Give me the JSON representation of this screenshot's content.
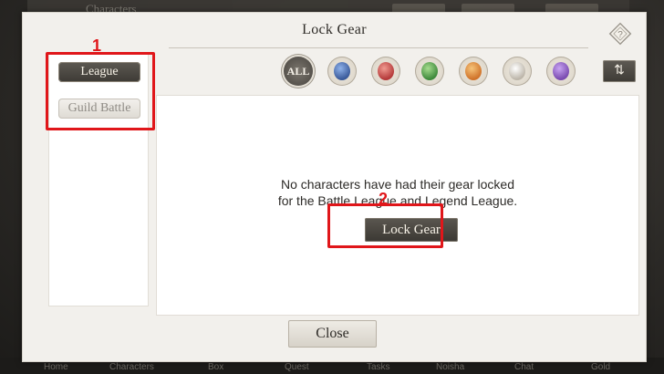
{
  "background": {
    "ghost_title": "Characters",
    "nav": [
      "Home",
      "Characters",
      "Box",
      "Quest",
      "Tasks",
      "Noisha",
      "Chat",
      "Gold"
    ]
  },
  "dialog": {
    "title": "Lock Gear",
    "help_icon": "help-diamond-icon",
    "sidebar": {
      "tabs": [
        {
          "label": "League",
          "active": true
        },
        {
          "label": "Guild Battle",
          "active": false
        }
      ]
    },
    "filters": {
      "all_label": "ALL",
      "elements": [
        {
          "name": "water-element-icon",
          "color": "#3a5a9a"
        },
        {
          "name": "fire-element-icon",
          "color": "#b53a3a"
        },
        {
          "name": "wind-element-icon",
          "color": "#3f8a3c"
        },
        {
          "name": "light-element-icon",
          "color": "#d0732a"
        },
        {
          "name": "neutral-element-icon",
          "color": "#bdb6aa"
        },
        {
          "name": "dark-element-icon",
          "color": "#7a4bb0"
        }
      ],
      "sort_label": "⇅"
    },
    "message_line1": "No characters have had their gear locked",
    "message_line2": "for the Battle League and Legend League.",
    "lock_button": "Lock Gear",
    "close_button": "Close"
  },
  "annotations": {
    "callout_1": "1",
    "callout_2": "2",
    "highlight_color": "#e0161a"
  }
}
